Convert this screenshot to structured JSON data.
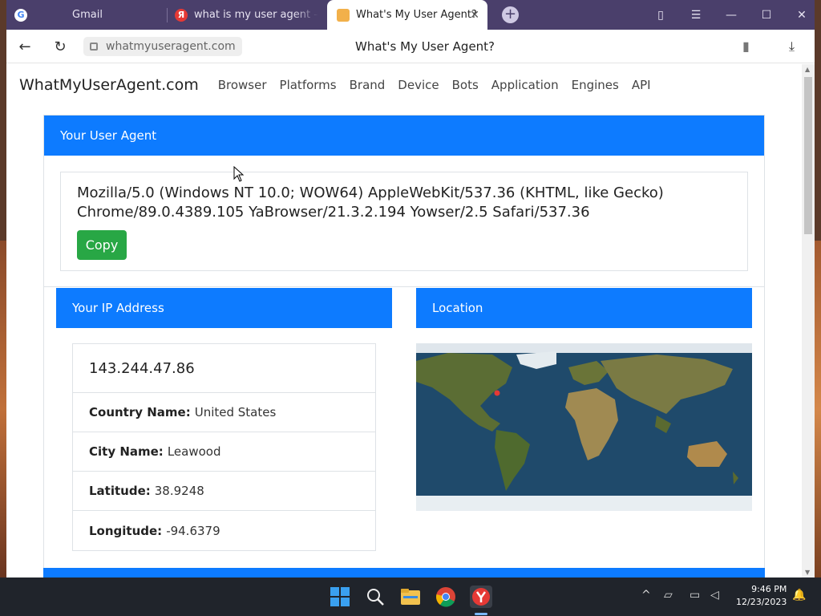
{
  "tabs": [
    {
      "label": "Gmail"
    },
    {
      "label": "what is my user agent — Я"
    },
    {
      "label": "What's My User Agent?"
    }
  ],
  "addressbar": {
    "url": "whatmyuseragent.com",
    "title": "What's My User Agent?"
  },
  "site": {
    "brand": "WhatMyUserAgent.com",
    "nav": [
      "Browser",
      "Platforms",
      "Brand",
      "Device",
      "Bots",
      "Application",
      "Engines",
      "API"
    ]
  },
  "ua_card": {
    "header": "Your User Agent",
    "ua_line1": "Mozilla/5.0 (Windows NT 10.0; WOW64) AppleWebKit/537.36 (KHTML, like Gecko)",
    "ua_line2": "Chrome/89.0.4389.105 YaBrowser/21.3.2.194 Yowser/2.5 Safari/537.36",
    "copy_label": "Copy"
  },
  "ip_card": {
    "header": "Your IP Address",
    "ip": "143.244.47.86",
    "country_label": "Country Name:",
    "country": "United States",
    "city_label": "City Name:",
    "city": "Leawood",
    "lat_label": "Latitude:",
    "lat": "38.9248",
    "lon_label": "Longitude:",
    "lon": "-94.6379"
  },
  "location_card": {
    "header": "Location"
  },
  "taskbar": {
    "time": "9:46 PM",
    "date": "12/23/2023"
  },
  "colors": {
    "accent": "#0d7bff",
    "copy_button": "#28a745",
    "tabbar": "#4a3f6b",
    "taskbar": "#20242b"
  }
}
